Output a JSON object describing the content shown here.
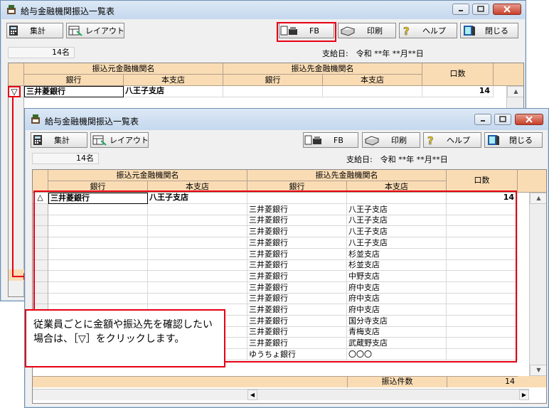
{
  "window": {
    "title": "給与金融機関振込一覧表",
    "toolbar": {
      "total_label": "集計",
      "layout_label": "レイアウト",
      "fb_label": "FB",
      "print_label": "印刷",
      "help_label": "ヘルプ",
      "close_label": "閉じる"
    },
    "employee_count": "14名",
    "payday": "支給日:　令和 **年 **月**日",
    "headers": {
      "source_group": "振込元金融機関名",
      "dest_group": "振込先金融機関名",
      "bank": "銀行",
      "branch": "本支店",
      "count": "口数"
    }
  },
  "summary_row": {
    "marker_collapsed": "▽",
    "marker_expanded": "△",
    "bank": "三井菱銀行",
    "branch": "八王子支店",
    "count": "14"
  },
  "detail_rows": [
    {
      "bank": "三井菱銀行",
      "branch": "八王子支店"
    },
    {
      "bank": "三井菱銀行",
      "branch": "八王子支店"
    },
    {
      "bank": "三井菱銀行",
      "branch": "八王子支店"
    },
    {
      "bank": "三井菱銀行",
      "branch": "八王子支店"
    },
    {
      "bank": "三井菱銀行",
      "branch": "杉並支店"
    },
    {
      "bank": "三井菱銀行",
      "branch": "杉並支店"
    },
    {
      "bank": "三井菱銀行",
      "branch": "中野支店"
    },
    {
      "bank": "三井菱銀行",
      "branch": "府中支店"
    },
    {
      "bank": "三井菱銀行",
      "branch": "府中支店"
    },
    {
      "bank": "三井菱銀行",
      "branch": "府中支店"
    },
    {
      "bank": "三井菱銀行",
      "branch": "国分寺支店"
    },
    {
      "bank": "三井菱銀行",
      "branch": "青梅支店"
    },
    {
      "bank": "三井菱銀行",
      "branch": "武蔵野支店"
    },
    {
      "bank": "ゆうちょ銀行",
      "branch": "〇〇〇"
    }
  ],
  "footer": {
    "transfer_count_label": "振込件数",
    "transfer_count": "14"
  },
  "callout": {
    "line1": "従業員ごとに金額や振込先を確認したい",
    "line2": "場合は、［▽］をクリックします。"
  },
  "colors": {
    "highlight": "#e60012",
    "header_bg": "#fadcb4"
  }
}
